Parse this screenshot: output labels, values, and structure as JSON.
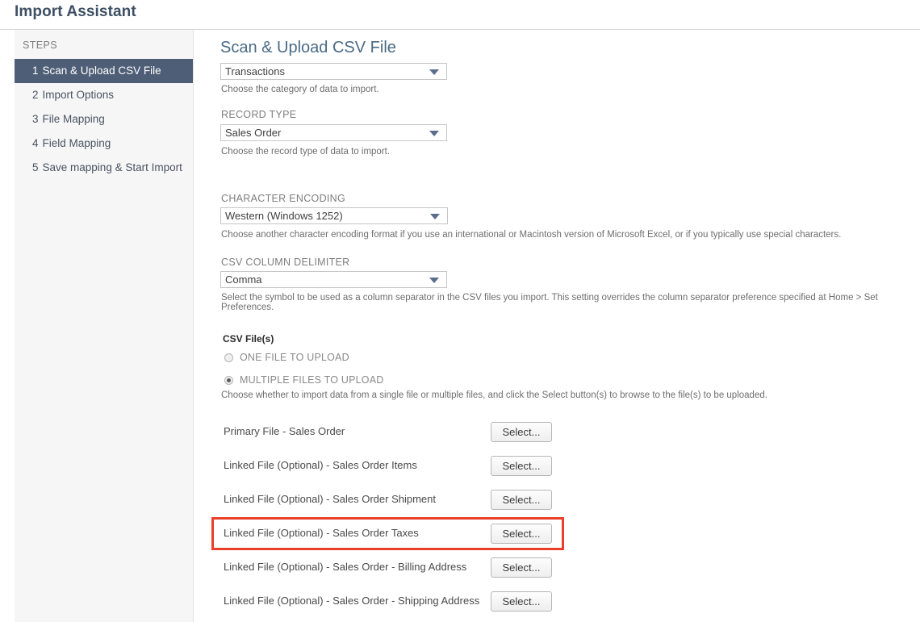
{
  "header": {
    "title": "Import Assistant"
  },
  "sidebar": {
    "heading": "STEPS",
    "items": [
      {
        "num": "1",
        "label": "Scan & Upload CSV File",
        "active": true
      },
      {
        "num": "2",
        "label": "Import Options",
        "active": false
      },
      {
        "num": "3",
        "label": "File Mapping",
        "active": false
      },
      {
        "num": "4",
        "label": "Field Mapping",
        "active": false
      },
      {
        "num": "5",
        "label": "Save mapping & Start Import",
        "active": false
      }
    ]
  },
  "main": {
    "section_title": "Scan & Upload CSV File",
    "import_type": {
      "value": "Transactions",
      "help": "Choose the category of data to import."
    },
    "record_type": {
      "label": "RECORD TYPE",
      "value": "Sales Order",
      "help": "Choose the record type of data to import."
    },
    "character_encoding": {
      "label": "CHARACTER ENCODING",
      "value": "Western (Windows 1252)",
      "help": "Choose another character encoding format if you use an international or Macintosh version of Microsoft Excel, or if you typically use special characters."
    },
    "csv_delimiter": {
      "label": "CSV COLUMN DELIMITER",
      "value": "Comma",
      "help": "Select the symbol to be used as a column separator in the CSV files you import. This setting overrides the column separator preference specified at Home > Set Preferences."
    },
    "csv_files": {
      "heading": "CSV File(s)",
      "options": [
        {
          "label": "ONE FILE TO UPLOAD",
          "checked": false
        },
        {
          "label": "MULTIPLE FILES TO UPLOAD",
          "checked": true
        }
      ],
      "help": "Choose whether to import data from a single file or multiple files, and click the Select button(s) to browse to the file(s) to be uploaded.",
      "button_label": "Select...",
      "rows": [
        {
          "label": "Primary File - Sales Order",
          "highlighted": false
        },
        {
          "label": "Linked File (Optional) - Sales Order Items",
          "highlighted": false
        },
        {
          "label": "Linked File (Optional) - Sales Order Shipment",
          "highlighted": false
        },
        {
          "label": "Linked File (Optional) - Sales Order Taxes",
          "highlighted": true
        },
        {
          "label": "Linked File (Optional) - Sales Order - Billing Address",
          "highlighted": false
        },
        {
          "label": "Linked File (Optional) - Sales Order - Shipping Address",
          "highlighted": false
        }
      ]
    }
  },
  "colors": {
    "accent": "#4e5e76",
    "heading": "#4a6a85",
    "highlight": "#e8402a"
  }
}
